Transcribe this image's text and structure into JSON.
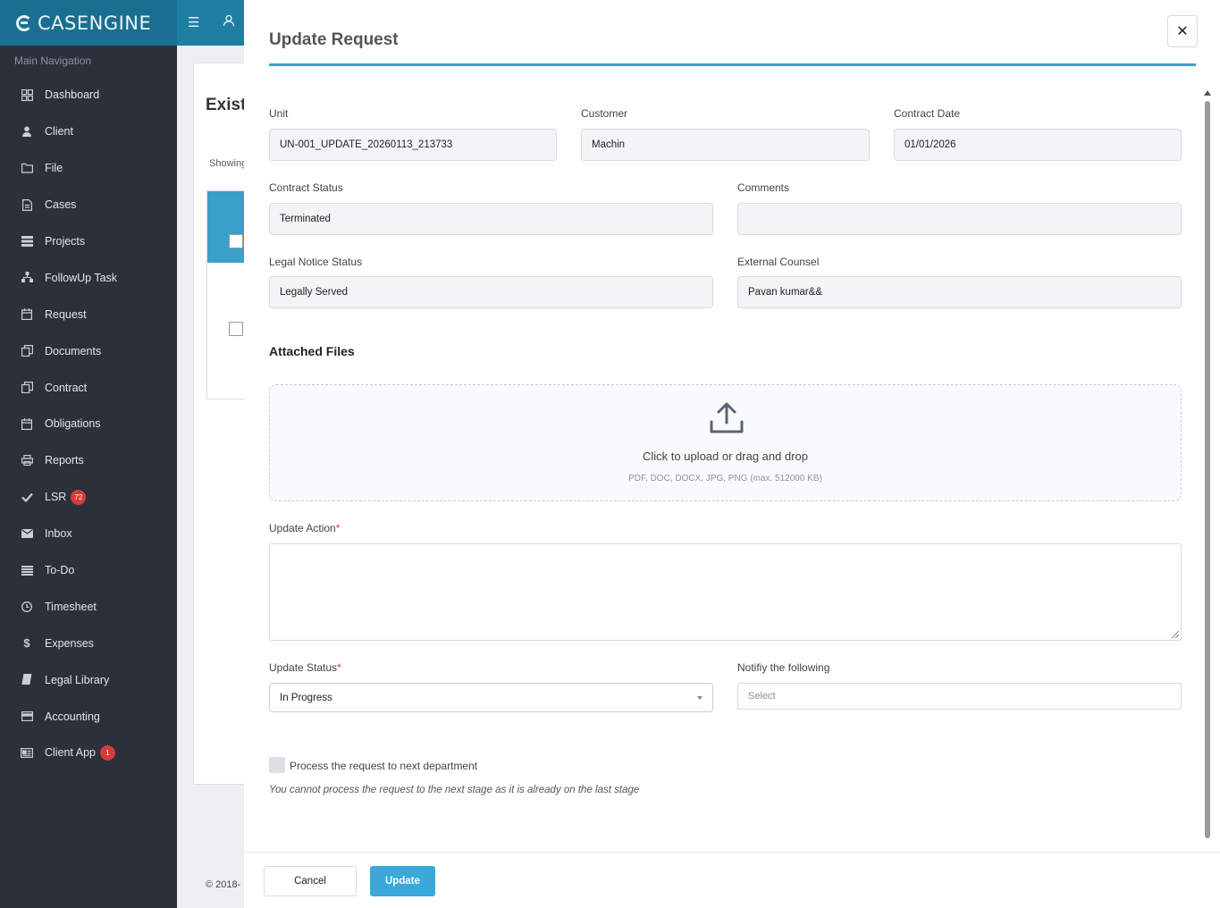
{
  "app": {
    "logo_text": "CASENGINE"
  },
  "sidebar": {
    "header": "Main Navigation",
    "items": [
      {
        "label": "Dashboard",
        "icon": "dashboard-icon"
      },
      {
        "label": "Client",
        "icon": "user-icon"
      },
      {
        "label": "File",
        "icon": "folder-icon"
      },
      {
        "label": "Cases",
        "icon": "document-icon"
      },
      {
        "label": "Projects",
        "icon": "projects-icon"
      },
      {
        "label": "FollowUp Task",
        "icon": "sitemap-icon"
      },
      {
        "label": "Request",
        "icon": "calendar-icon"
      },
      {
        "label": "Documents",
        "icon": "copy-icon"
      },
      {
        "label": "Contract",
        "icon": "copy-icon"
      },
      {
        "label": "Obligations",
        "icon": "calendar-icon"
      },
      {
        "label": "Reports",
        "icon": "print-icon"
      },
      {
        "label": "LSR",
        "icon": "check-icon",
        "badge": "72"
      },
      {
        "label": "Inbox",
        "icon": "envelope-icon"
      },
      {
        "label": "To-Do",
        "icon": "list-icon"
      },
      {
        "label": "Timesheet",
        "icon": "clock-icon"
      },
      {
        "label": "Expenses",
        "icon": "dollar-icon"
      },
      {
        "label": "Legal Library",
        "icon": "book-icon"
      },
      {
        "label": "Accounting",
        "icon": "credit-card-icon"
      },
      {
        "label": "Client App",
        "icon": "id-card-icon",
        "badge": "1"
      }
    ]
  },
  "background": {
    "title": "Exist",
    "showing": "Showing",
    "footer": "© 2018-"
  },
  "modal": {
    "title": "Update Request",
    "close_glyph": "✕",
    "fields": {
      "unit": {
        "label": "Unit",
        "value": "UN-001_UPDATE_20260113_213733"
      },
      "customer": {
        "label": "Customer",
        "value": "Machin"
      },
      "contract_date": {
        "label": "Contract Date",
        "value": "01/01/2026"
      },
      "contract_status": {
        "label": "Contract Status",
        "value": "Terminated"
      },
      "comments": {
        "label": "Comments",
        "value": ""
      },
      "legal_notice_status": {
        "label": "Legal Notice Status",
        "value": "Legally Served"
      },
      "external_counsel": {
        "label": "External Counsel",
        "value": "Pavan kumar&&"
      }
    },
    "attached_files": {
      "title": "Attached Files",
      "main_text": "Click to upload or drag and drop",
      "sub_text": "PDF, DOC, DOCX, JPG, PNG (max. 512000 KB)"
    },
    "update_action": {
      "label": "Update Action",
      "required": "*",
      "value": ""
    },
    "update_status": {
      "label": "Update Status",
      "required": "*",
      "value": "In Progress"
    },
    "notify": {
      "label": "Notifiy the following",
      "placeholder": "Select"
    },
    "process_next": {
      "label": "Process the request to next department",
      "checked": false
    },
    "note": "You cannot process the request to the next stage as it is already on the last stage",
    "footer": {
      "cancel_label": "Cancel",
      "update_label": "Update"
    }
  },
  "colors": {
    "header": "#1e7fa3",
    "sidebar": "#2b303b",
    "accent": "#3aa0c9",
    "primary_button": "#3aa8d9",
    "badge": "#d63a3a"
  }
}
